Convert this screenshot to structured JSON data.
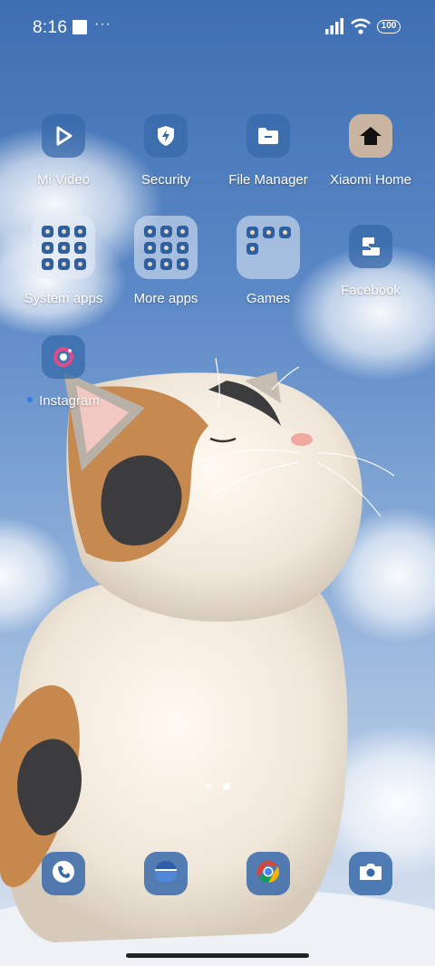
{
  "status_bar": {
    "time": "8:16",
    "dots": "···",
    "battery": "100"
  },
  "home": {
    "row1": [
      {
        "label": "Mi Video",
        "icon": "play-icon"
      },
      {
        "label": "Security",
        "icon": "shield-bolt-icon"
      },
      {
        "label": "File Manager",
        "icon": "folder-icon"
      },
      {
        "label": "Xiaomi Home",
        "icon": "house-icon"
      }
    ],
    "row2": [
      {
        "label": "System apps",
        "icon": "folder-grid-icon"
      },
      {
        "label": "More apps",
        "icon": "folder-grid-icon"
      },
      {
        "label": "Games",
        "icon": "folder-grid-icon"
      },
      {
        "label": "Facebook",
        "icon": "facebook-icon"
      }
    ],
    "row3": [
      {
        "label": "Instagram",
        "icon": "instagram-icon"
      }
    ]
  },
  "dock": [
    {
      "icon": "phone-icon"
    },
    {
      "icon": "messages-icon"
    },
    {
      "icon": "chrome-icon"
    },
    {
      "icon": "camera-icon"
    }
  ],
  "pager": {
    "pages": 2,
    "current": 2
  },
  "colors": {
    "icon_bg": "#3769aa",
    "accent": "#2f7bf0"
  }
}
